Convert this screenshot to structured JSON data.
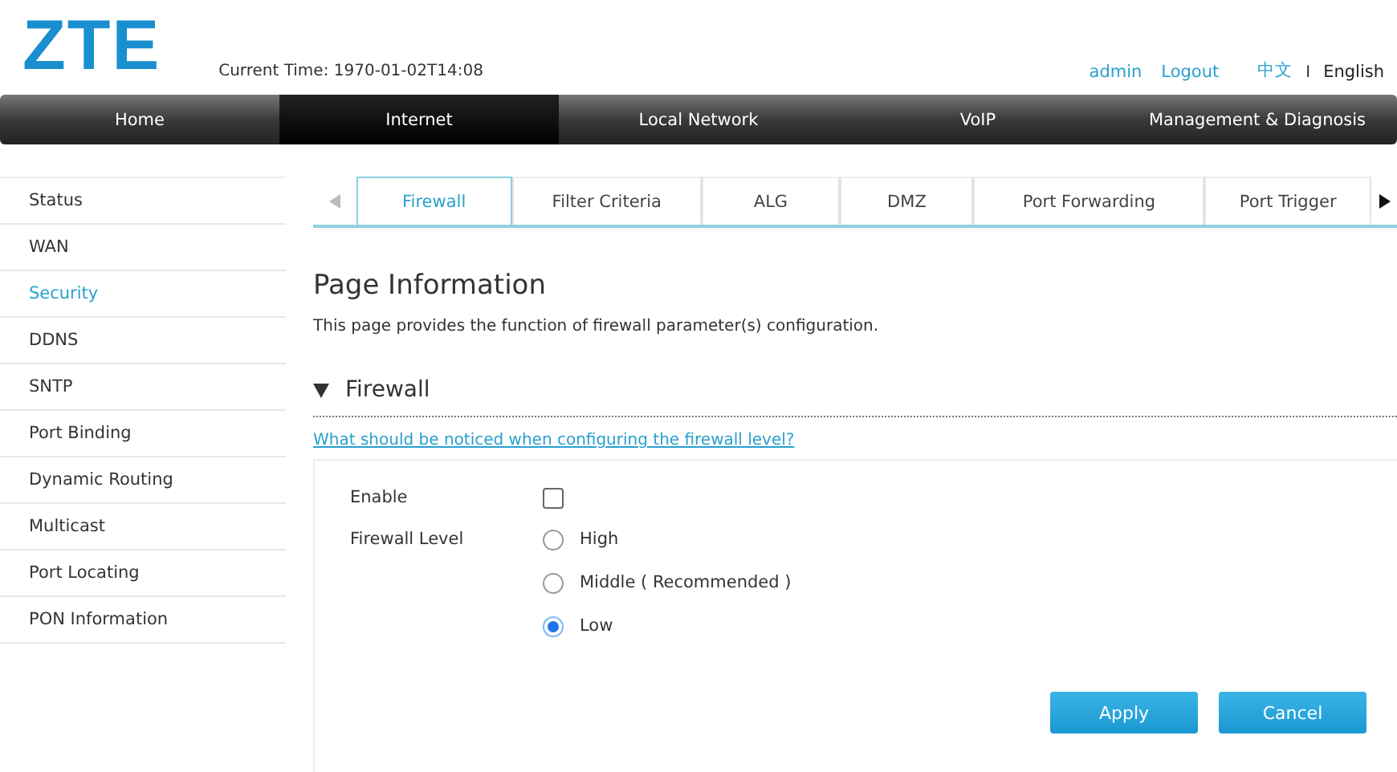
{
  "header": {
    "logo": "ZTE",
    "current_time_label": "Current Time:",
    "current_time": "1970-01-02T14:08",
    "user": "admin",
    "logout": "Logout",
    "languages": [
      {
        "label": "中文",
        "selected": false
      },
      {
        "label": "English",
        "selected": true
      }
    ],
    "language_separator": "I"
  },
  "nav": [
    {
      "label": "Home",
      "selected": false
    },
    {
      "label": "Internet",
      "selected": true
    },
    {
      "label": "Local Network",
      "selected": false
    },
    {
      "label": "VoIP",
      "selected": false
    },
    {
      "label": "Management & Diagnosis",
      "selected": false
    }
  ],
  "sidebar": {
    "items": [
      {
        "label": "Status",
        "selected": false
      },
      {
        "label": "WAN",
        "selected": false
      },
      {
        "label": "Security",
        "selected": true
      },
      {
        "label": "DDNS",
        "selected": false
      },
      {
        "label": "SNTP",
        "selected": false
      },
      {
        "label": "Port Binding",
        "selected": false
      },
      {
        "label": "Dynamic Routing",
        "selected": false
      },
      {
        "label": "Multicast",
        "selected": false
      },
      {
        "label": "Port Locating",
        "selected": false
      },
      {
        "label": "PON Information",
        "selected": false
      }
    ]
  },
  "tabs": [
    {
      "label": "Firewall",
      "selected": true
    },
    {
      "label": "Filter Criteria",
      "selected": false
    },
    {
      "label": "ALG",
      "selected": false
    },
    {
      "label": "DMZ",
      "selected": false
    },
    {
      "label": "Port Forwarding",
      "selected": false
    },
    {
      "label": "Port Trigger",
      "selected": false
    }
  ],
  "page_title": "Page Information",
  "page_description": "This page provides the function of firewall parameter(s) configuration.",
  "section": {
    "title": "Firewall",
    "expanded": true,
    "help_link": "What should be noticed when configuring the firewall level?",
    "enable": {
      "label": "Enable",
      "checked": false
    },
    "level": {
      "label": "Firewall Level",
      "options": [
        {
          "label": "High",
          "selected": false
        },
        {
          "label": "Middle ( Recommended )",
          "selected": false
        },
        {
          "label": "Low",
          "selected": true
        }
      ]
    }
  },
  "buttons": [
    "Apply",
    "Cancel"
  ]
}
